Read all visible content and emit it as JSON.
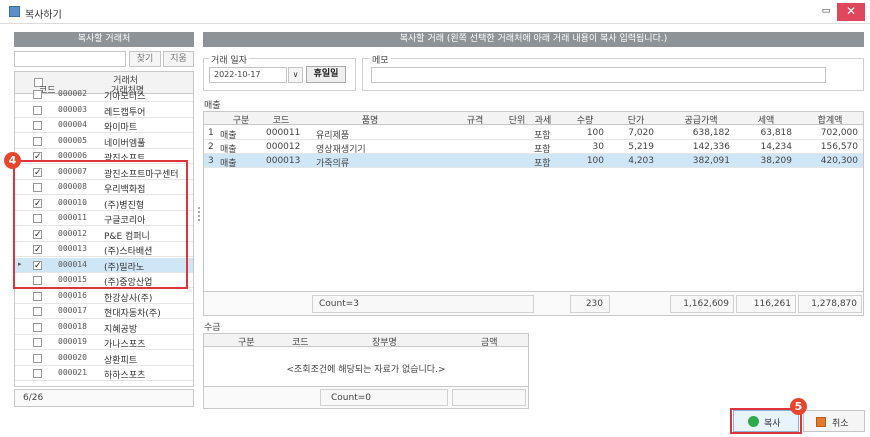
{
  "window": {
    "title": "복사하기",
    "min_glyph": "▭",
    "close_glyph": "✕",
    "close_color": "#e0465c"
  },
  "left_panel": {
    "header": "복사할 거래처",
    "search_button": "찾기",
    "clear_button": "지움",
    "columns": {
      "group": "거래처",
      "code": "코드",
      "name": "거래처명"
    },
    "rows": [
      {
        "code": "000002",
        "name": "기아모터스",
        "checked": false,
        "selected": false
      },
      {
        "code": "000003",
        "name": "레드캡투어",
        "checked": false,
        "selected": false
      },
      {
        "code": "000004",
        "name": "와이마트",
        "checked": false,
        "selected": false
      },
      {
        "code": "000005",
        "name": "네이버엠풀",
        "checked": false,
        "selected": false
      },
      {
        "code": "000006",
        "name": "광진소프트",
        "checked": true,
        "selected": false
      },
      {
        "code": "000007",
        "name": "광진소프트마구센터",
        "checked": true,
        "selected": false
      },
      {
        "code": "000008",
        "name": "우리백화점",
        "checked": false,
        "selected": false
      },
      {
        "code": "000010",
        "name": "(주)병진형",
        "checked": true,
        "selected": false
      },
      {
        "code": "000011",
        "name": "구글코리아",
        "checked": false,
        "selected": false
      },
      {
        "code": "000012",
        "name": "P&E 컴퍼니",
        "checked": true,
        "selected": false
      },
      {
        "code": "000013",
        "name": "(주)스타배션",
        "checked": true,
        "selected": false
      },
      {
        "code": "000014",
        "name": "(주)밀라노",
        "checked": true,
        "selected": true
      },
      {
        "code": "000015",
        "name": "(주)중앙산업",
        "checked": false,
        "selected": false
      },
      {
        "code": "000016",
        "name": "한강상사(주)",
        "checked": false,
        "selected": false
      },
      {
        "code": "000017",
        "name": "현대자동차(주)",
        "checked": false,
        "selected": false
      },
      {
        "code": "000018",
        "name": "지혜공방",
        "checked": false,
        "selected": false
      },
      {
        "code": "000019",
        "name": "가나스포츠",
        "checked": false,
        "selected": false
      },
      {
        "code": "000020",
        "name": "상환피트",
        "checked": false,
        "selected": false
      },
      {
        "code": "000021",
        "name": "하하스포츠",
        "checked": false,
        "selected": false
      }
    ],
    "footer": "6/26"
  },
  "right_panel": {
    "header": "복사할 거래 (왼쪽 선택한 거래처에 아래 거래 내용이 복사 입력됩니다.)",
    "date_label": "거래 일자",
    "date_value": "2022-10-17",
    "dropdown_glyph": "∨",
    "holiday_button": "휴일일",
    "memo_label": "메모",
    "memo_value": "",
    "sales_label": "매출",
    "sales_columns": [
      "구분",
      "코드",
      "품명",
      "규격",
      "단위",
      "과세",
      "수량",
      "단가",
      "공급가액",
      "세액",
      "합계액"
    ],
    "sales_rows": [
      {
        "no": "1",
        "type": "매출",
        "code": "000011",
        "item": "유리제품",
        "spec": "",
        "unit": "",
        "tax": "포함",
        "qty": "100",
        "price": "7,020",
        "supply": "638,182",
        "vat": "63,818",
        "total": "702,000"
      },
      {
        "no": "2",
        "type": "매출",
        "code": "000012",
        "item": "영상재생기기",
        "spec": "",
        "unit": "",
        "tax": "포함",
        "qty": "30",
        "price": "5,219",
        "supply": "142,336",
        "vat": "14,234",
        "total": "156,570"
      },
      {
        "no": "3",
        "type": "매출",
        "code": "000013",
        "item": "가죽의류",
        "spec": "",
        "unit": "",
        "tax": "포함",
        "qty": "100",
        "price": "4,203",
        "supply": "382,091",
        "vat": "38,209",
        "total": "420,300"
      }
    ],
    "sales_footer": {
      "count": "Count=3",
      "qty": "230",
      "supply": "1,162,609",
      "vat": "116,261",
      "total": "1,278,870"
    },
    "receipt_label": "수금",
    "receipt_columns": [
      "구분",
      "코드",
      "장부명",
      "금액"
    ],
    "receipt_empty": "<조회조건에 해당되는 자료가 없습니다.>",
    "receipt_footer": {
      "count": "Count=0"
    }
  },
  "actions": {
    "copy": "복사",
    "cancel": "취소"
  },
  "callouts": {
    "left": "4",
    "copy": "5",
    "color": "#e0343b"
  }
}
